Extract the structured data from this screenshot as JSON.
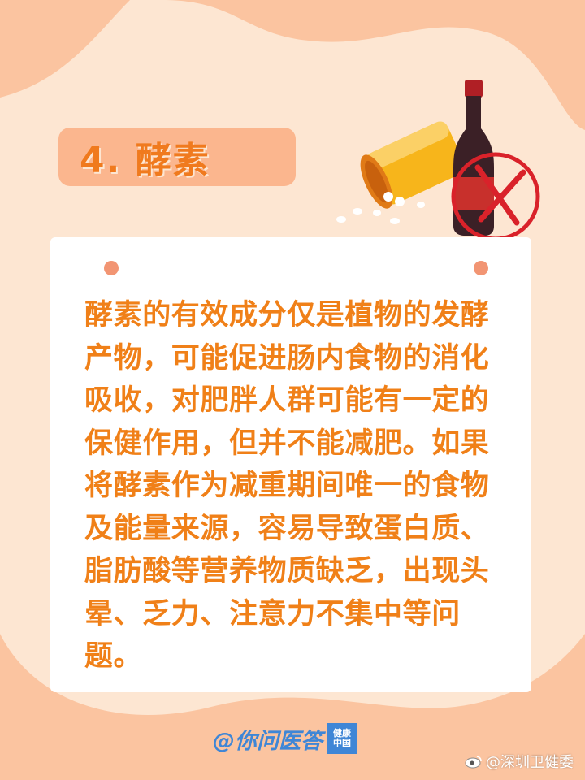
{
  "colors": {
    "background": "#fde6d2",
    "accent_orange": "#f08018",
    "title_box": "#fbb68e",
    "dot": "#f29573",
    "brand_blue": "#3f86d6"
  },
  "title": "4. 酵素",
  "body_text": "酵素的有效成分仅是植物的发酵产物，可能促进肠内食物的消化吸收，对肥胖人群可能有一定的保健作用，但并不能减肥。如果将酵素作为减重期间唯一的食物及能量来源，容易导致蛋白质、脂肪酸等营养物质缺乏，出现头晕、乏力、注意力不集中等问题。",
  "footer": {
    "brand": "@你问医答",
    "badge_text": "健康中国"
  },
  "watermark": {
    "text": "@深圳卫健委"
  },
  "icons": {
    "pill_bottle": "pill-bottle-icon",
    "wine_bottle": "wine-bottle-icon",
    "prohibited": "prohibited-x-icon",
    "weibo": "weibo-icon"
  }
}
